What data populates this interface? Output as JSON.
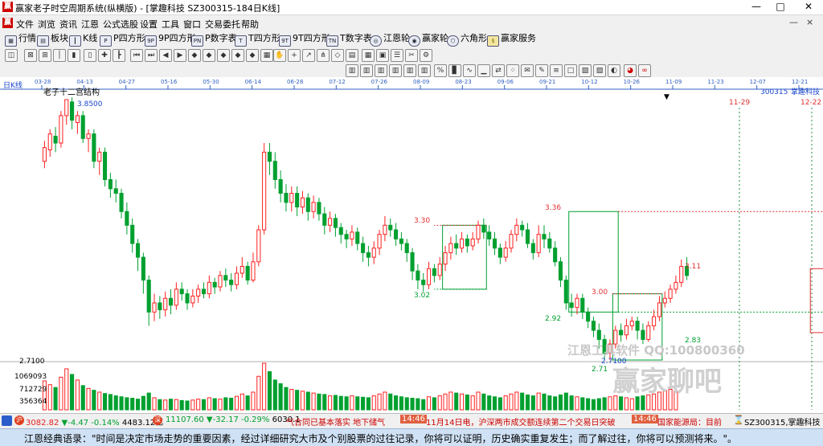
{
  "window": {
    "title": "赢家老子时空周期系统(纵横版) - [掌趣科技  SZ300315-184日K线]",
    "app_icon": "赢",
    "buttons": {
      "minimize": "—",
      "maximize": "□",
      "close": "✕"
    }
  },
  "menu": {
    "logo": "赢",
    "items": [
      "文件",
      "浏览",
      "资讯",
      "江恩",
      "公式选股",
      "设置",
      "工具",
      "窗口",
      "交易委托",
      "帮助"
    ],
    "right_controls": {
      "minimize": "—",
      "close": "×"
    }
  },
  "toolbar1": [
    {
      "label": "行情",
      "icon": "grid-icon"
    },
    {
      "label": "板块",
      "icon": "blocks-icon"
    },
    {
      "label": "K线",
      "icon": "kline-icon"
    },
    {
      "label": "P四方形",
      "icon": "p-square-icon",
      "badge": "P"
    },
    {
      "label": "9P四方形",
      "icon": "9p-square-icon",
      "badge": "9P"
    },
    {
      "label": "P数字表",
      "icon": "p-table-icon",
      "badge": "PN"
    },
    {
      "label": "T四方形",
      "icon": "t-square-icon",
      "badge": "T"
    },
    {
      "label": "9T四方形",
      "icon": "9t-square-icon",
      "badge": "9T"
    },
    {
      "label": "T数字表",
      "icon": "t-table-icon",
      "badge": "TN"
    },
    {
      "label": "江恩轮",
      "icon": "gann-wheel-icon"
    },
    {
      "label": "赢家轮",
      "icon": "winner-wheel-icon"
    },
    {
      "label": "六角形",
      "icon": "hexagon-icon"
    },
    {
      "label": "赢家服务",
      "icon": "dollar-icon"
    }
  ],
  "chart": {
    "period_label": "日K线",
    "structure_label": "老子十二宫结构",
    "stock_code": "300315",
    "stock_name": "掌趣科技",
    "date_ticks": [
      "03-28",
      "04-13",
      "04-27",
      "05-16",
      "05-30",
      "06-14",
      "06-28",
      "07-12",
      "07-26",
      "08-09",
      "08-23",
      "09-06",
      "09-21",
      "10-12",
      "10-26",
      "11-09",
      "11-23",
      "12-07",
      "12-21"
    ],
    "cycle_dates": {
      "first": "11-29",
      "second": "12-22"
    },
    "price_labels": {
      "high": "3.8500",
      "box1_top": "3.30",
      "box1_bottom": "3.02",
      "box2_top": "3.36",
      "box2_bottom": "2.92",
      "box3_top": "3.00",
      "box3_low": "2.71",
      "low": "2.7100",
      "box4_top": "3.11",
      "box4_bottom": "2.83",
      "axis_low": "2.7100"
    },
    "volume_ticks": [
      "1069093",
      "712729",
      "356364"
    ],
    "watermark": {
      "line1": "江恩工具软件  QQ:100800360",
      "line2": "赢家聊吧"
    }
  },
  "statusbar": {
    "index1": {
      "value": "3082.82",
      "change": "▼-4.47",
      "pct": "-0.14%",
      "amount": "4483.12亿"
    },
    "index2": {
      "value": "11107.60",
      "change": "▼-32.17",
      "pct": "-0.29%",
      "amount": "6030.1"
    },
    "ticker1": "气合同已基本落实 地下储气",
    "time1": "14:46",
    "ticker2": "11月14日电，沪深两市成交额连续第二个交易日突破",
    "time2": "14:46",
    "ticker3": "国家能源局：目前",
    "stock": "SZ300315,掌趣科技"
  },
  "footer": {
    "text": "江恩经典语录：\"时间是决定市场走势的重要因素，经过详细研究大市及个别股票的过往记录，你将可以证明，历史确实重复发生；而了解过往，你将可以预测将来。\"。"
  },
  "colors": {
    "up": "#ff2020",
    "down": "#00a030",
    "box_green": "#00a030",
    "box_red": "#e03030",
    "axis_blue": "#1a44cc"
  },
  "chart_data": {
    "type": "candlestick",
    "y_range": [
      2.71,
      3.85
    ],
    "candles": [
      [
        3.58,
        3.64,
        3.55,
        3.67
      ],
      [
        3.63,
        3.7,
        3.6,
        3.72
      ],
      [
        3.69,
        3.66,
        3.62,
        3.73
      ],
      [
        3.66,
        3.78,
        3.64,
        3.8
      ],
      [
        3.78,
        3.85,
        3.74,
        3.85
      ],
      [
        3.84,
        3.76,
        3.72,
        3.86
      ],
      [
        3.75,
        3.78,
        3.7,
        3.8
      ],
      [
        3.78,
        3.68,
        3.66,
        3.8
      ],
      [
        3.68,
        3.7,
        3.62,
        3.72
      ],
      [
        3.7,
        3.58,
        3.55,
        3.72
      ],
      [
        3.58,
        3.62,
        3.52,
        3.64
      ],
      [
        3.62,
        3.5,
        3.47,
        3.64
      ],
      [
        3.5,
        3.46,
        3.42,
        3.53
      ],
      [
        3.46,
        3.44,
        3.4,
        3.5
      ],
      [
        3.44,
        3.36,
        3.33,
        3.46
      ],
      [
        3.36,
        3.3,
        3.26,
        3.4
      ],
      [
        3.3,
        3.22,
        3.18,
        3.33
      ],
      [
        3.22,
        3.16,
        3.1,
        3.24
      ],
      [
        3.16,
        3.06,
        3.0,
        3.18
      ],
      [
        3.06,
        2.92,
        2.86,
        3.08
      ],
      [
        2.92,
        2.96,
        2.88,
        3.0
      ],
      [
        2.96,
        2.93,
        2.89,
        2.99
      ],
      [
        2.93,
        2.98,
        2.9,
        3.01
      ],
      [
        2.98,
        2.95,
        2.91,
        3.02
      ],
      [
        2.95,
        3.02,
        2.93,
        3.05
      ],
      [
        3.02,
        3.0,
        2.97,
        3.05
      ],
      [
        3.0,
        2.96,
        2.93,
        3.02
      ],
      [
        2.96,
        2.99,
        2.94,
        3.02
      ],
      [
        2.99,
        3.02,
        2.96,
        3.04
      ],
      [
        3.02,
        3.0,
        2.98,
        3.05
      ],
      [
        3.0,
        3.05,
        2.98,
        3.08
      ],
      [
        3.05,
        3.03,
        3.0,
        3.07
      ],
      [
        3.03,
        3.08,
        3.01,
        3.1
      ],
      [
        3.08,
        3.06,
        3.03,
        3.11
      ],
      [
        3.06,
        3.04,
        3.01,
        3.09
      ],
      [
        3.04,
        3.09,
        3.02,
        3.12
      ],
      [
        3.09,
        3.12,
        3.07,
        3.16
      ],
      [
        3.12,
        3.06,
        3.04,
        3.14
      ],
      [
        3.06,
        3.14,
        3.05,
        3.18
      ],
      [
        3.14,
        3.28,
        3.12,
        3.3
      ],
      [
        3.28,
        3.62,
        3.26,
        3.66
      ],
      [
        3.62,
        3.58,
        3.52,
        3.66
      ],
      [
        3.58,
        3.5,
        3.46,
        3.62
      ],
      [
        3.5,
        3.44,
        3.4,
        3.54
      ],
      [
        3.44,
        3.4,
        3.36,
        3.48
      ],
      [
        3.4,
        3.44,
        3.36,
        3.47
      ],
      [
        3.44,
        3.38,
        3.34,
        3.47
      ],
      [
        3.38,
        3.42,
        3.35,
        3.45
      ],
      [
        3.42,
        3.36,
        3.32,
        3.44
      ],
      [
        3.36,
        3.4,
        3.33,
        3.43
      ],
      [
        3.4,
        3.35,
        3.32,
        3.42
      ],
      [
        3.35,
        3.3,
        3.26,
        3.38
      ],
      [
        3.3,
        3.33,
        3.27,
        3.36
      ],
      [
        3.33,
        3.29,
        3.25,
        3.35
      ],
      [
        3.29,
        3.26,
        3.22,
        3.31
      ],
      [
        3.26,
        3.24,
        3.2,
        3.28
      ],
      [
        3.24,
        3.27,
        3.21,
        3.3
      ],
      [
        3.27,
        3.22,
        3.19,
        3.29
      ],
      [
        3.22,
        3.18,
        3.14,
        3.25
      ],
      [
        3.18,
        3.16,
        3.12,
        3.21
      ],
      [
        3.16,
        3.2,
        3.13,
        3.23
      ],
      [
        3.2,
        3.26,
        3.17,
        3.28
      ],
      [
        3.26,
        3.3,
        3.23,
        3.34
      ],
      [
        3.3,
        3.28,
        3.25,
        3.33
      ],
      [
        3.28,
        3.24,
        3.21,
        3.31
      ],
      [
        3.24,
        3.22,
        3.19,
        3.27
      ],
      [
        3.22,
        3.18,
        3.14,
        3.24
      ],
      [
        3.18,
        3.1,
        3.06,
        3.2
      ],
      [
        3.1,
        3.06,
        3.02,
        3.13
      ],
      [
        3.06,
        3.04,
        3.01,
        3.09
      ],
      [
        3.04,
        3.11,
        3.02,
        3.14
      ],
      [
        3.11,
        3.08,
        3.05,
        3.13
      ],
      [
        3.08,
        3.13,
        3.06,
        3.16
      ],
      [
        3.13,
        3.18,
        3.1,
        3.21
      ],
      [
        3.18,
        3.22,
        3.15,
        3.25
      ],
      [
        3.22,
        3.2,
        3.17,
        3.26
      ],
      [
        3.2,
        3.24,
        3.18,
        3.27
      ],
      [
        3.24,
        3.21,
        3.18,
        3.26
      ],
      [
        3.21,
        3.24,
        3.19,
        3.27
      ],
      [
        3.24,
        3.3,
        3.22,
        3.32
      ],
      [
        3.3,
        3.27,
        3.24,
        3.33
      ],
      [
        3.27,
        3.24,
        3.21,
        3.3
      ],
      [
        3.24,
        3.2,
        3.17,
        3.27
      ],
      [
        3.2,
        3.16,
        3.13,
        3.22
      ],
      [
        3.16,
        3.2,
        3.14,
        3.23
      ],
      [
        3.2,
        3.26,
        3.18,
        3.28
      ],
      [
        3.26,
        3.3,
        3.23,
        3.33
      ],
      [
        3.3,
        3.28,
        3.25,
        3.32
      ],
      [
        3.28,
        3.22,
        3.2,
        3.31
      ],
      [
        3.22,
        3.18,
        3.15,
        3.24
      ],
      [
        3.18,
        3.26,
        3.16,
        3.3
      ],
      [
        3.26,
        3.24,
        3.2,
        3.3
      ],
      [
        3.24,
        3.2,
        3.18,
        3.27
      ],
      [
        3.2,
        3.14,
        3.12,
        3.23
      ],
      [
        3.14,
        3.06,
        3.03,
        3.16
      ],
      [
        3.06,
        2.96,
        2.93,
        3.08
      ],
      [
        2.96,
        2.94,
        2.9,
        3.0
      ],
      [
        2.94,
        2.98,
        2.91,
        3.0
      ],
      [
        2.98,
        2.92,
        2.89,
        3.0
      ],
      [
        2.92,
        2.88,
        2.85,
        2.94
      ],
      [
        2.88,
        2.84,
        2.81,
        2.9
      ],
      [
        2.84,
        2.8,
        2.76,
        2.87
      ],
      [
        2.8,
        2.74,
        2.71,
        2.82
      ],
      [
        2.74,
        2.78,
        2.71,
        2.8
      ],
      [
        2.78,
        2.84,
        2.76,
        2.86
      ],
      [
        2.84,
        2.82,
        2.79,
        2.87
      ],
      [
        2.82,
        2.86,
        2.8,
        2.89
      ],
      [
        2.86,
        2.88,
        2.84,
        2.9
      ],
      [
        2.88,
        2.84,
        2.8,
        2.9
      ],
      [
        2.84,
        2.8,
        2.78,
        2.87
      ],
      [
        2.8,
        2.86,
        2.79,
        2.88
      ],
      [
        2.86,
        2.9,
        2.84,
        2.93
      ],
      [
        2.9,
        2.96,
        2.88,
        2.99
      ],
      [
        2.96,
        2.98,
        2.94,
        3.01
      ],
      [
        2.98,
        3.02,
        2.96,
        3.04
      ],
      [
        3.02,
        3.05,
        3.0,
        3.08
      ],
      [
        3.05,
        3.12,
        3.03,
        3.15
      ],
      [
        3.12,
        3.08,
        3.06,
        3.16
      ]
    ],
    "volume": [
      620,
      540,
      480,
      700,
      880,
      760,
      640,
      520,
      460,
      420,
      380,
      350,
      330,
      300,
      280,
      260,
      250,
      230,
      290,
      360,
      260,
      220,
      210,
      230,
      220,
      200,
      190,
      210,
      230,
      220,
      260,
      240,
      230,
      260,
      250,
      290,
      340,
      300,
      380,
      720,
      1000,
      820,
      640,
      560,
      480,
      440,
      420,
      400,
      380,
      360,
      340,
      330,
      300,
      310,
      290,
      280,
      300,
      280,
      270,
      260,
      300,
      340,
      380,
      340,
      300,
      280,
      260,
      250,
      240,
      220,
      280,
      260,
      300,
      340,
      380,
      360,
      340,
      320,
      300,
      380,
      340,
      300,
      280,
      260,
      300,
      340,
      380,
      360,
      320,
      300,
      360,
      340,
      300,
      280,
      320,
      360,
      300,
      280,
      260,
      240,
      220,
      240,
      260,
      280,
      300,
      280,
      260,
      240,
      280,
      300,
      320,
      340,
      380,
      420,
      440,
      400
    ]
  }
}
